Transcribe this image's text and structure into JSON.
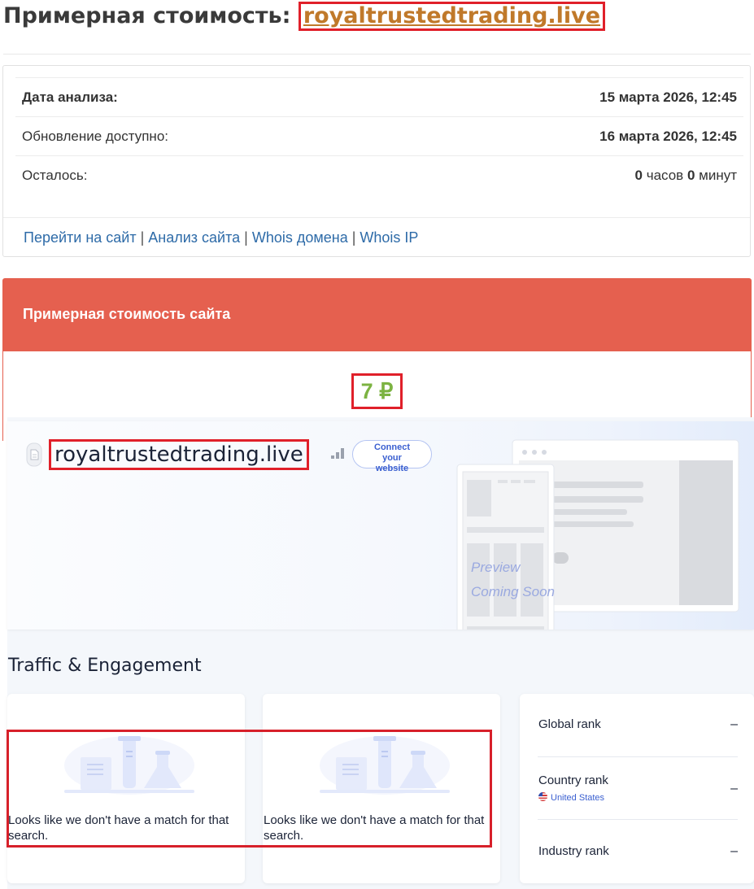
{
  "page": {
    "title_prefix": "Примерная стоимость: ",
    "title_domain": "royaltrustedtrading.live"
  },
  "analysis": {
    "rows": [
      {
        "label": "Дата анализа:",
        "value": "15 марта 2026, 12:45"
      },
      {
        "label": "Обновление доступно:",
        "value": "16 марта 2026, 12:45"
      },
      {
        "label": "Осталось:",
        "hours": "0",
        "hours_unit": " часов ",
        "minutes": "0",
        "minutes_unit": " минут"
      }
    ],
    "links": [
      "Перейти на сайт",
      "Анализ сайта",
      "Whois домена",
      "Whois IP"
    ],
    "separator": "|"
  },
  "cost": {
    "header": "Примерная стоимость сайта",
    "value": "7 ₽"
  },
  "similarweb": {
    "domain": "royaltrustedtrading.live",
    "connect_label": [
      "Connect",
      "your",
      "website"
    ],
    "preview_text": [
      "Preview",
      "Coming Soon"
    ],
    "section_title": "Traffic & Engagement",
    "no_match_message": "Looks like we don't have a match for that search.",
    "ranks": [
      {
        "label": "Global rank",
        "value": "–"
      },
      {
        "label": "Country rank",
        "sub": "United States",
        "value": "–"
      },
      {
        "label": "Industry rank",
        "value": "–"
      }
    ]
  },
  "colors": {
    "accent_red": "#e5604f",
    "link_blue": "#2e6ba8",
    "price_green": "#7cb342",
    "domain_orange": "#c0792a",
    "highlight_red": "#e0202a"
  },
  "icons": [
    "document-icon",
    "signal-bars-icon",
    "flask-illustration-icon",
    "us-flag-icon"
  ]
}
